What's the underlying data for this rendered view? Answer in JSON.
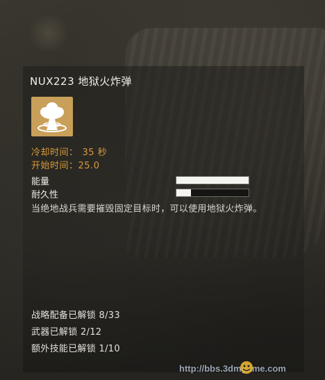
{
  "title": "NUX223 地狱火炸弹",
  "icon": "mushroom-cloud-icon",
  "colors": {
    "accent": "#d89b3a",
    "icon_bg": "#c9a05a",
    "text": "#ecebe5"
  },
  "stats": [
    {
      "label": "冷却时间：",
      "value": "35 秒"
    },
    {
      "label": "开始时间：",
      "value": "25.0"
    }
  ],
  "bars": [
    {
      "label": "能量",
      "fill": 1.0
    },
    {
      "label": "耐久性",
      "fill": 0.2
    }
  ],
  "description": "当绝地战兵需要摧毁固定目标时，可以使用地狱火炸弹。",
  "progress": [
    {
      "label": "战略配备已解锁",
      "value": "8/33"
    },
    {
      "label": "武器已解锁",
      "value": "2/12"
    },
    {
      "label": "额外技能已解锁",
      "value": "1/10"
    }
  ],
  "watermark": "http://bbs.3dmgame.com"
}
